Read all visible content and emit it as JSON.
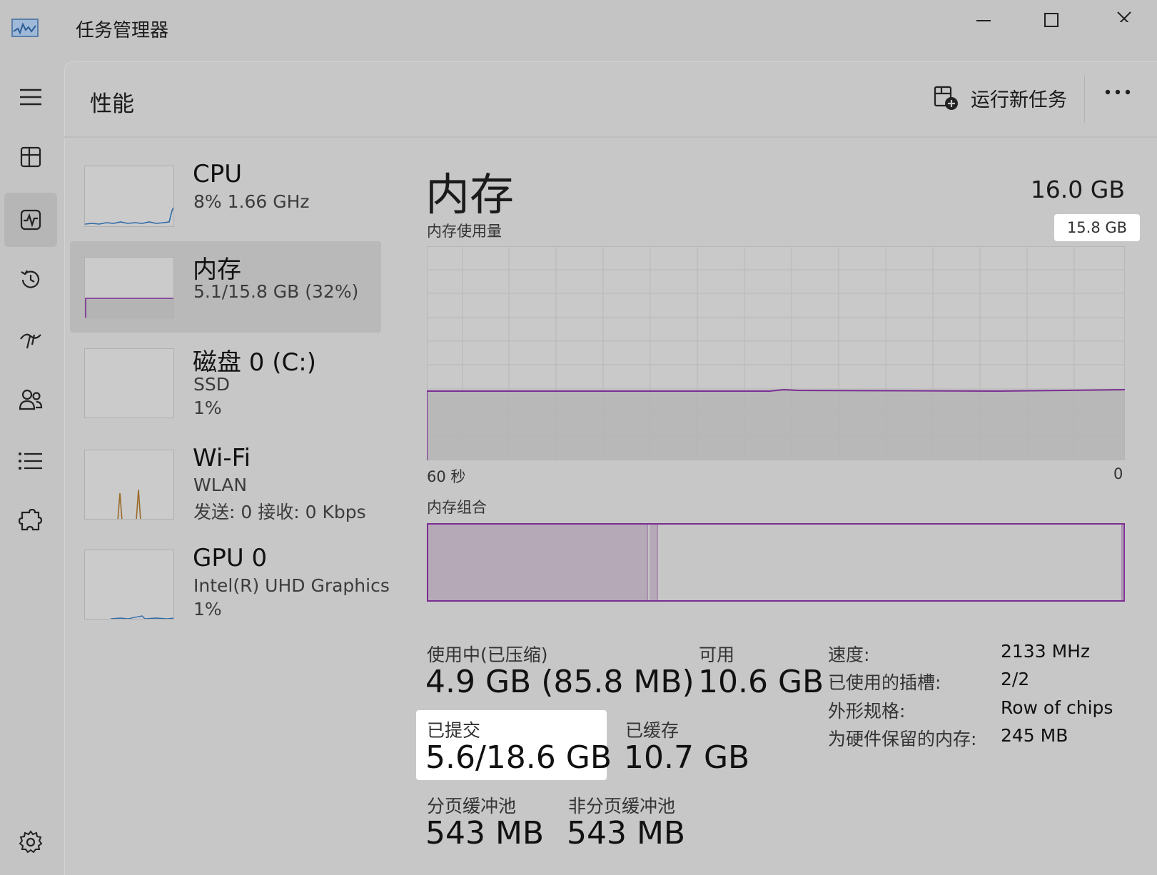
{
  "window": {
    "title": "任务管理器"
  },
  "header": {
    "page_title": "性能",
    "run_task_label": "运行新任务"
  },
  "devices": [
    {
      "name": "CPU",
      "line1": "8% 1.66 GHz",
      "line2": ""
    },
    {
      "name": "内存",
      "line1": "5.1/15.8 GB (32%)",
      "line2": ""
    },
    {
      "name": "磁盘 0 (C:)",
      "line1": "SSD",
      "line2": "1%"
    },
    {
      "name": "Wi-Fi",
      "line1": "WLAN",
      "line2": "发送: 0 接收: 0 Kbps"
    },
    {
      "name": "GPU 0",
      "line1": "Intel(R) UHD Graphics",
      "line2": "1%"
    }
  ],
  "memory": {
    "title": "内存",
    "total": "16.0 GB",
    "usage_label": "内存使用量",
    "usage_max": "15.8 GB",
    "axis_left": "60 秒",
    "axis_right": "0",
    "composition_label": "内存组合",
    "stats": {
      "in_use_label": "使用中(已压缩)",
      "in_use_value": "4.9 GB (85.8 MB)",
      "available_label": "可用",
      "available_value": "10.6 GB",
      "committed_label": "已提交",
      "committed_value": "5.6/18.6 GB",
      "cached_label": "已缓存",
      "cached_value": "10.7 GB",
      "paged_label": "分页缓冲池",
      "paged_value": "543 MB",
      "nonpaged_label": "非分页缓冲池",
      "nonpaged_value": "543 MB"
    },
    "specs": [
      {
        "label": "速度:",
        "value": "2133 MHz"
      },
      {
        "label": "已使用的插槽:",
        "value": "2/2"
      },
      {
        "label": "外形规格:",
        "value": "Row of chips"
      },
      {
        "label": "为硬件保留的内存:",
        "value": "245 MB"
      }
    ]
  },
  "colors": {
    "memory_accent": "#7a2e92",
    "wifi_accent": "#9a6a2a",
    "cpu_accent": "#2e6aa8"
  }
}
